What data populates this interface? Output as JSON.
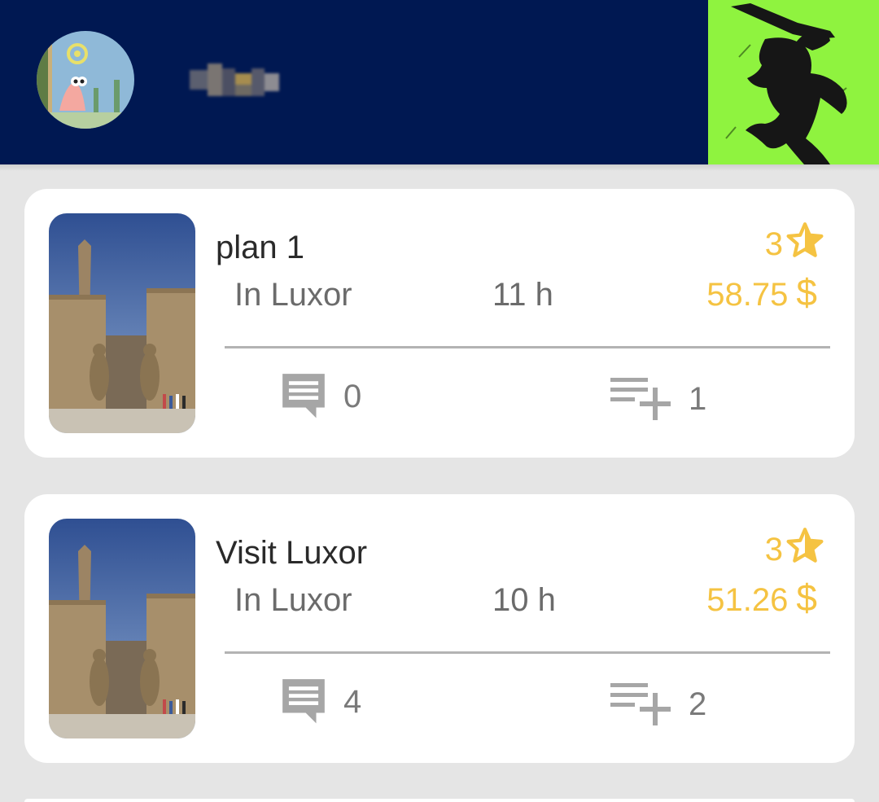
{
  "header": {
    "avatar_icon": "profile-avatar",
    "art_icon": "ninja-silhouette"
  },
  "colors": {
    "header_bg": "#001852",
    "accent_green": "#8ff33f",
    "gold": "#f5c342",
    "background": "#e5e5e5"
  },
  "plans": [
    {
      "title": "plan 1",
      "location": "In Luxor",
      "duration": "11 h",
      "rating": "3",
      "price": "58.75",
      "currency": "$",
      "comments": "0",
      "added": "1"
    },
    {
      "title": "Visit Luxor",
      "location": "In Luxor",
      "duration": "10 h",
      "rating": "3",
      "price": "51.26",
      "currency": "$",
      "comments": "4",
      "added": "2"
    }
  ]
}
